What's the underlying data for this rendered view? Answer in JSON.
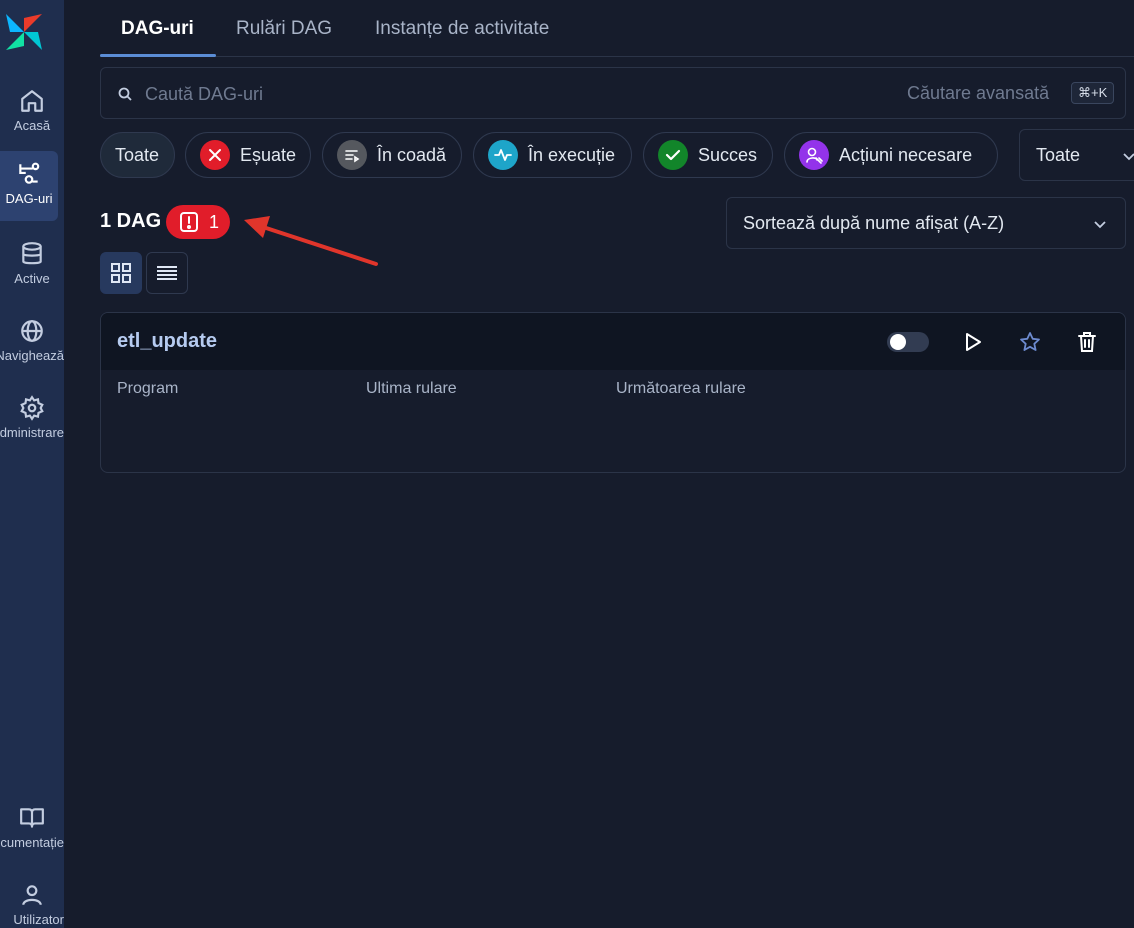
{
  "sidebar": {
    "items": [
      {
        "label": "Acasă",
        "icon": "home-icon"
      },
      {
        "label": "DAG-uri",
        "icon": "dag-icon"
      },
      {
        "label": "Active",
        "icon": "database-icon"
      },
      {
        "label": "Navighează",
        "icon": "globe-icon"
      },
      {
        "label": "Administrare",
        "icon": "gear-icon"
      },
      {
        "label": "Documentație",
        "icon": "book-icon"
      },
      {
        "label": "Utilizator",
        "icon": "user-icon"
      }
    ]
  },
  "tabs": [
    {
      "label": "DAG-uri"
    },
    {
      "label": "Rulări DAG"
    },
    {
      "label": "Instanțe de activitate"
    }
  ],
  "search": {
    "placeholder": "Caută DAG-uri",
    "advanced_label": "Căutare avansată",
    "shortcut": "⌘+K"
  },
  "filters": [
    {
      "label": "Toate"
    },
    {
      "label": "Eșuate",
      "color": "#e11d2a"
    },
    {
      "label": "În coadă",
      "color": "#55585e"
    },
    {
      "label": "În execuție",
      "color": "#1ea5c9"
    },
    {
      "label": "Succes",
      "color": "#12852a"
    },
    {
      "label": "Acțiuni necesare",
      "color": "#9333ea"
    }
  ],
  "tag_select": {
    "value": "Toate"
  },
  "summary": {
    "count_label": "1 DAG",
    "import_errors": "1"
  },
  "sort": {
    "value": "Sortează după nume afișat (A-Z)"
  },
  "dag": {
    "id": "etl_update",
    "columns": [
      "Program",
      "Ultima rulare",
      "Următoarea rulare"
    ]
  },
  "colors": {
    "background": "#161c2c",
    "sidebar": "#1f2e4e",
    "accent": "#5b8dd6",
    "error": "#e11d2a",
    "annotation_arrow": "#e0352b"
  }
}
